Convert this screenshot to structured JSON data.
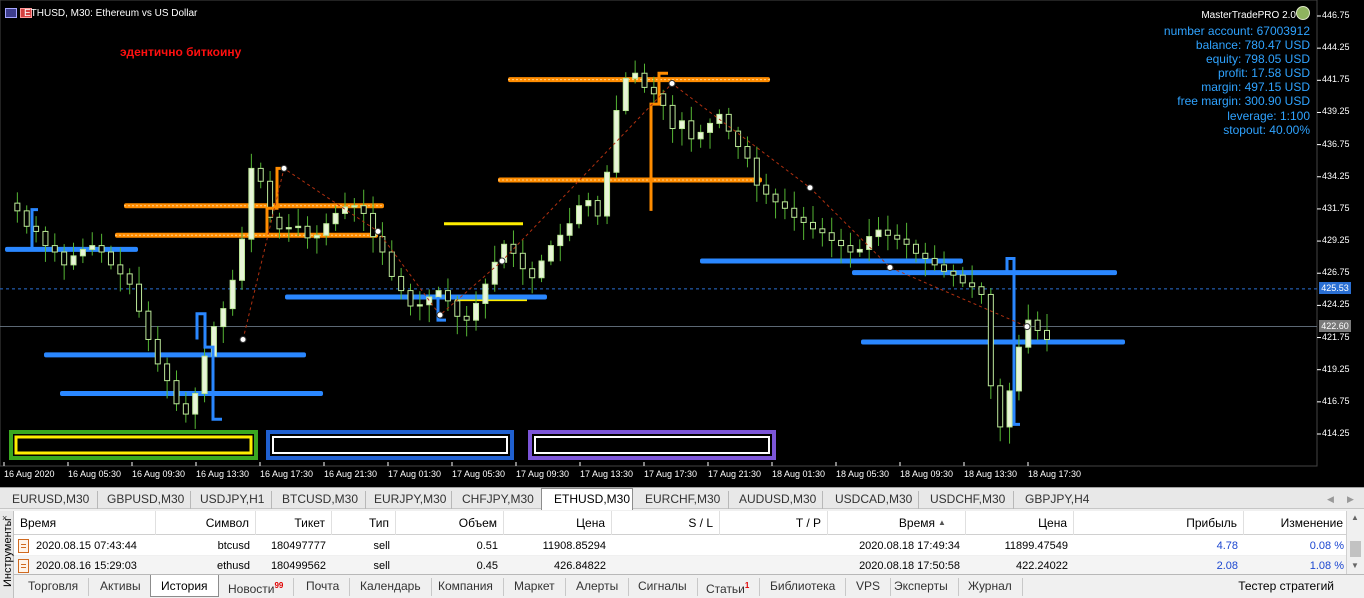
{
  "chart": {
    "title": "ETHUSD, M30:  Ethereum vs US Dollar",
    "note": "эдентично биткоину",
    "ea_name": "MasterTradePRO 2.0",
    "account": [
      "number account: 67003912",
      "balance: 780.47 USD",
      "equity: 798.05 USD",
      "profit: 17.58 USD",
      "margin: 497.15 USD",
      "free margin: 300.90 USD",
      "leverage: 1:100",
      "stopout: 40.00%"
    ],
    "price_current": "425.53",
    "price_cross": "422.60",
    "colors": {
      "bull": "#bde89a",
      "bear": "#bde89a",
      "resistance": "#ff8c00",
      "support": "#2a87ff",
      "yellow": "#ffee00",
      "violet": "#7c55d8"
    }
  },
  "chart_data": {
    "type": "candlestick",
    "y_axis": [
      "446.75",
      "444.25",
      "441.75",
      "439.25",
      "436.75",
      "434.25",
      "431.75",
      "429.25",
      "426.75",
      "424.25",
      "421.75",
      "419.25",
      "416.75",
      "414.25"
    ],
    "x_axis": [
      "16 Aug 2020",
      "16 Aug 05:30",
      "16 Aug 09:30",
      "16 Aug 13:30",
      "16 Aug 17:30",
      "16 Aug 21:30",
      "17 Aug 01:30",
      "17 Aug 05:30",
      "17 Aug 09:30",
      "17 Aug 13:30",
      "17 Aug 17:30",
      "17 Aug 21:30",
      "18 Aug 01:30",
      "18 Aug 05:30",
      "18 Aug 09:30",
      "18 Aug 13:30",
      "18 Aug 17:30"
    ],
    "ylim": [
      413.2,
      447.6
    ],
    "close_path": [
      432.2,
      431.6,
      430.4,
      430.0,
      428.9,
      428.4,
      427.4,
      428.1,
      428.6,
      428.9,
      428.4,
      427.4,
      426.7,
      425.9,
      423.8,
      421.6,
      419.7,
      418.4,
      416.6,
      415.8,
      417.4,
      420.3,
      422.6,
      424.0,
      426.2,
      429.4,
      434.9,
      433.9,
      431.1,
      430.2,
      430.3,
      430.4,
      429.5,
      429.7,
      430.6,
      431.4,
      431.9,
      432.0,
      431.4,
      429.6,
      428.4,
      426.5,
      425.4,
      424.2,
      424.3,
      424.9,
      425.4,
      424.6,
      423.4,
      423.1,
      424.4,
      425.9,
      427.6,
      429.0,
      428.3,
      427.1,
      426.4,
      427.7,
      428.9,
      429.7,
      430.6,
      432.0,
      432.4,
      431.2,
      434.6,
      439.4,
      441.9,
      442.3,
      441.2,
      440.7,
      439.8,
      438.0,
      438.6,
      437.2,
      437.7,
      438.4,
      439.1,
      437.8,
      436.6,
      435.7,
      433.6,
      432.9,
      432.3,
      431.8,
      431.1,
      430.7,
      430.2,
      429.9,
      429.3,
      428.9,
      428.4,
      428.6,
      429.6,
      430.1,
      429.7,
      429.4,
      429.0,
      428.3,
      427.9,
      427.4,
      426.9,
      426.6,
      426.0,
      425.7,
      425.1,
      418.0,
      414.8,
      417.6,
      421.0,
      423.1,
      422.3,
      421.6
    ],
    "levels": [
      {
        "kind": "orange",
        "price": 441.8,
        "x0": 508,
        "x1": 770
      },
      {
        "kind": "orange",
        "price": 434.0,
        "x0": 498,
        "x1": 762
      },
      {
        "kind": "orange",
        "price": 432.0,
        "x0": 124,
        "x1": 384
      },
      {
        "kind": "orange",
        "price": 429.7,
        "x0": 115,
        "x1": 378
      },
      {
        "kind": "yellow",
        "price": 430.6,
        "x0": 444,
        "x1": 523
      },
      {
        "kind": "yellow",
        "price": 424.7,
        "x0": 455,
        "x1": 527
      },
      {
        "kind": "blue",
        "price": 428.6,
        "x0": 5,
        "x1": 138
      },
      {
        "kind": "blue",
        "price": 427.7,
        "x0": 700,
        "x1": 963
      },
      {
        "kind": "blue",
        "price": 426.8,
        "x0": 852,
        "x1": 1117
      },
      {
        "kind": "blue",
        "price": 424.9,
        "x0": 285,
        "x1": 547
      },
      {
        "kind": "blue",
        "price": 421.4,
        "x0": 861,
        "x1": 1125
      },
      {
        "kind": "blue",
        "price": 420.4,
        "x0": 44,
        "x1": 306
      },
      {
        "kind": "blue",
        "price": 417.4,
        "x0": 60,
        "x1": 323
      }
    ]
  },
  "symbol_tabs": [
    "EURUSD,M30",
    "GBPUSD,M30",
    "USDJPY,H1",
    "BTCUSD,M30",
    "EURJPY,M30",
    "CHFJPY,M30",
    "ETHUSD,M30",
    "EURCHF,M30",
    "AUDUSD,M30",
    "USDCAD,M30",
    "USDCHF,M30",
    "GBPJPY,H4"
  ],
  "active_symbol": "ETHUSD,M30",
  "terminal": {
    "side_label": "Инструменты",
    "headers": [
      "Время",
      "Символ",
      "Тикет",
      "Тип",
      "Объем",
      "Цена",
      "S / L",
      "T / P",
      "Время",
      "Цена",
      "Прибыль",
      "Изменение"
    ],
    "rows": [
      {
        "open_time": "2020.08.15 07:43:44",
        "symbol": "btcusd",
        "ticket": "180497777",
        "type": "sell",
        "volume": "0.51",
        "open_price": "11908.85294",
        "sl": "",
        "tp": "",
        "close_time": "2020.08.18 17:49:34",
        "close_price": "11899.47549",
        "profit": "4.78",
        "change": "0.08 %"
      },
      {
        "open_time": "2020.08.16 15:29:03",
        "symbol": "ethusd",
        "ticket": "180499562",
        "type": "sell",
        "volume": "0.45",
        "open_price": "426.84822",
        "sl": "",
        "tp": "",
        "close_time": "2020.08.18 17:50:58",
        "close_price": "422.24022",
        "profit": "2.08",
        "change": "1.08 %"
      }
    ],
    "tabs": [
      "Торговля",
      "Активы",
      "История",
      "Новости",
      "Почта",
      "Календарь",
      "Компания",
      "Маркет",
      "Алерты",
      "Сигналы",
      "Статьи",
      "Библиотека",
      "VPS",
      "Эксперты",
      "Журнал"
    ],
    "active_tab": "История",
    "news_badge": "99",
    "articles_badge": "1",
    "tester": "Тестер стратегий"
  }
}
